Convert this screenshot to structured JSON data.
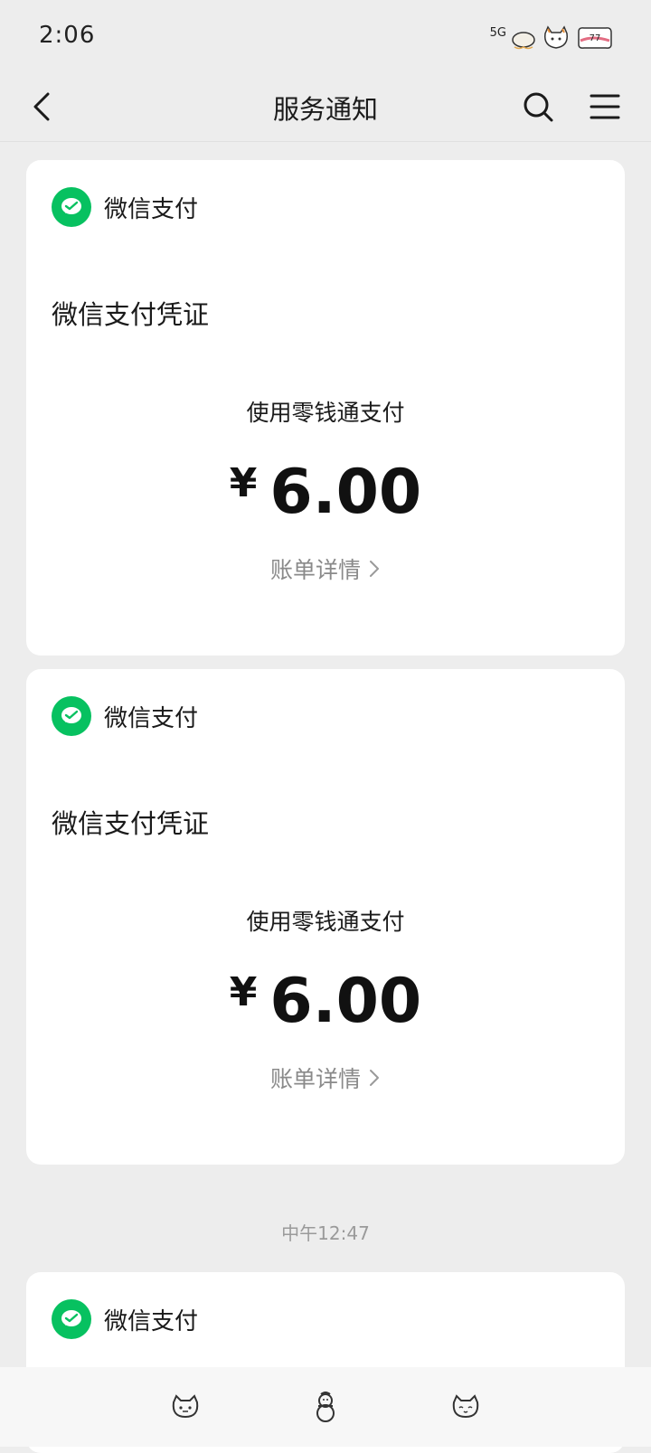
{
  "status_bar": {
    "time": "2:06",
    "network_label": "5G"
  },
  "nav": {
    "title": "服务通知"
  },
  "messages": [
    {
      "source": "微信支付",
      "title": "微信支付凭证",
      "pay_method": "使用零钱通支付",
      "currency": "¥",
      "amount": "6.00",
      "detail_label": "账单详情"
    },
    {
      "source": "微信支付",
      "title": "微信支付凭证",
      "pay_method": "使用零钱通支付",
      "currency": "¥",
      "amount": "6.00",
      "detail_label": "账单详情"
    }
  ],
  "divider_time": "中午12:47",
  "partial_message": {
    "source": "微信支付"
  },
  "colors": {
    "wechat_green": "#07c160",
    "background": "#ededed"
  },
  "icons": {
    "back": "chevron-left-icon",
    "search": "search-icon",
    "menu": "menu-icon",
    "wechat_pay": "wechat-pay-icon",
    "bill_arrow": "chevron-right-icon",
    "bottom": [
      "cat-face-icon",
      "snowman-icon",
      "cat-face-icon"
    ]
  }
}
